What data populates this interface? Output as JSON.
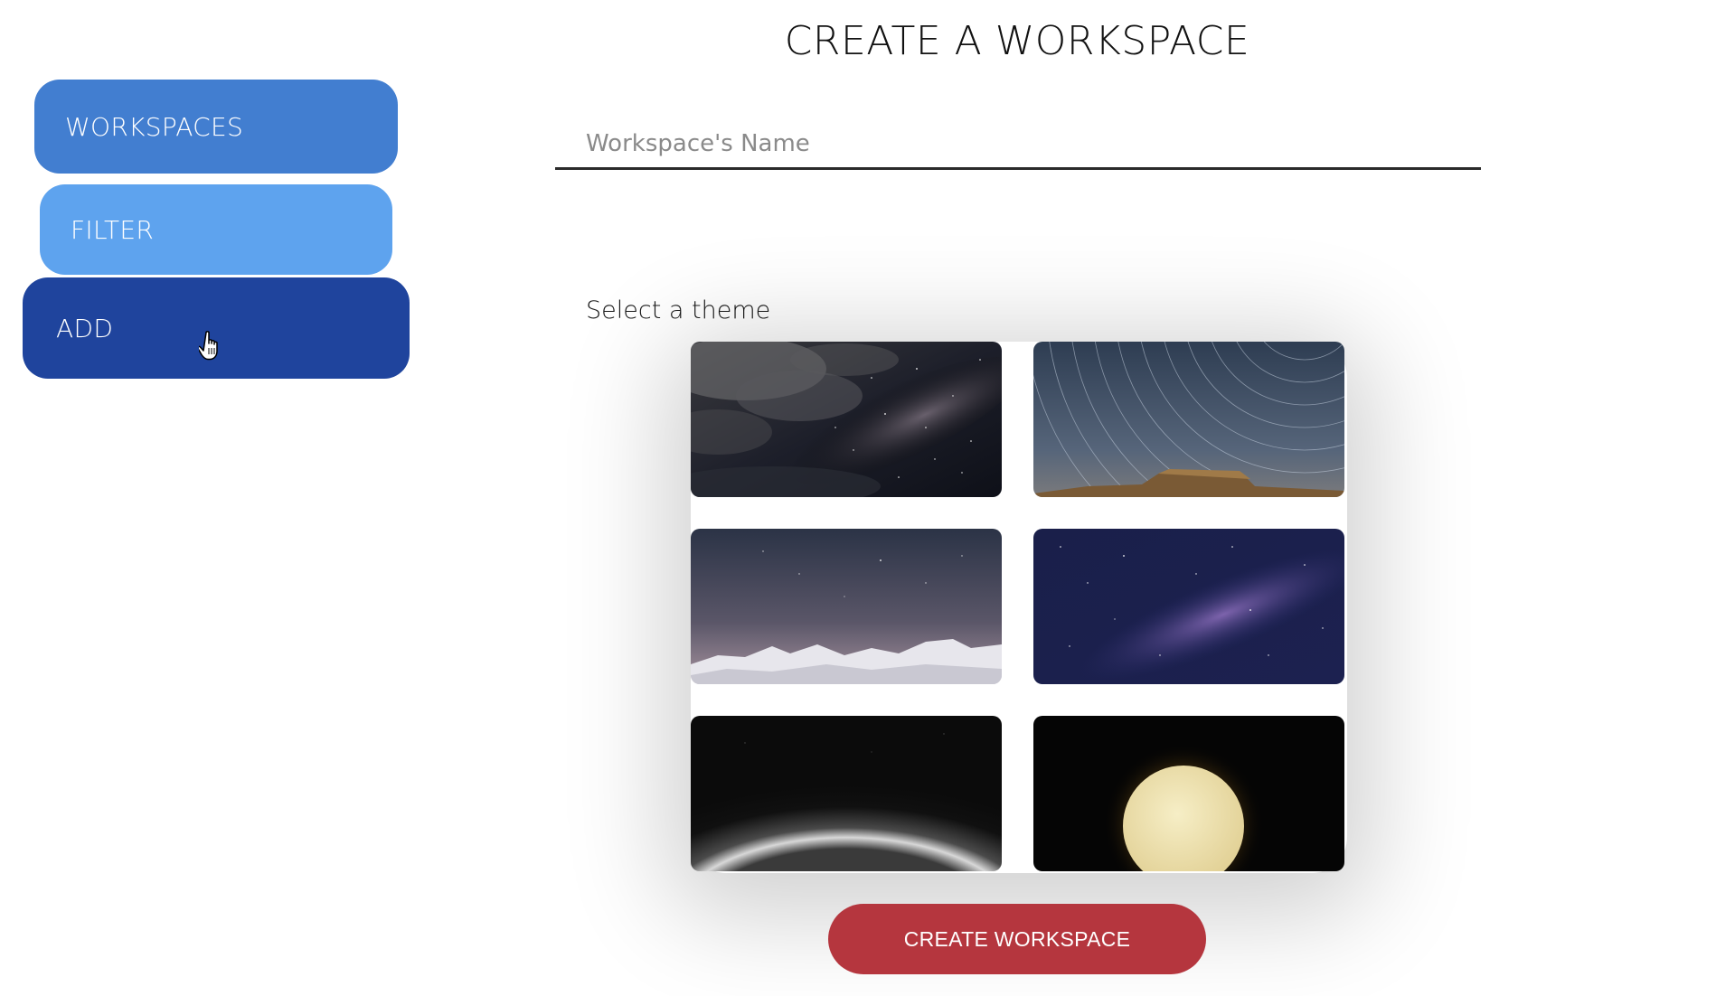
{
  "sidebar": {
    "workspaces_label": "WORKSPACES",
    "filter_label": "FILTER",
    "add_label": "ADD"
  },
  "main": {
    "title": "CREATE A WORKSPACE",
    "name_input": {
      "placeholder": "Workspace's Name",
      "value": ""
    },
    "theme_label": "Select a theme",
    "themes": [
      {
        "name": "milky-way-clouds"
      },
      {
        "name": "star-trails-mesa"
      },
      {
        "name": "snowy-mountains-night"
      },
      {
        "name": "purple-milky-way"
      },
      {
        "name": "black-white-planet-horizon"
      },
      {
        "name": "glowing-moon"
      }
    ],
    "create_button_label": "CREATE WORKSPACE"
  },
  "colors": {
    "workspaces_button": "#427ed0",
    "filter_button": "#5ea3ee",
    "add_button": "#1f449d",
    "create_button": "#b5363e"
  },
  "cursor": {
    "icon": "hand-pointer-icon"
  }
}
